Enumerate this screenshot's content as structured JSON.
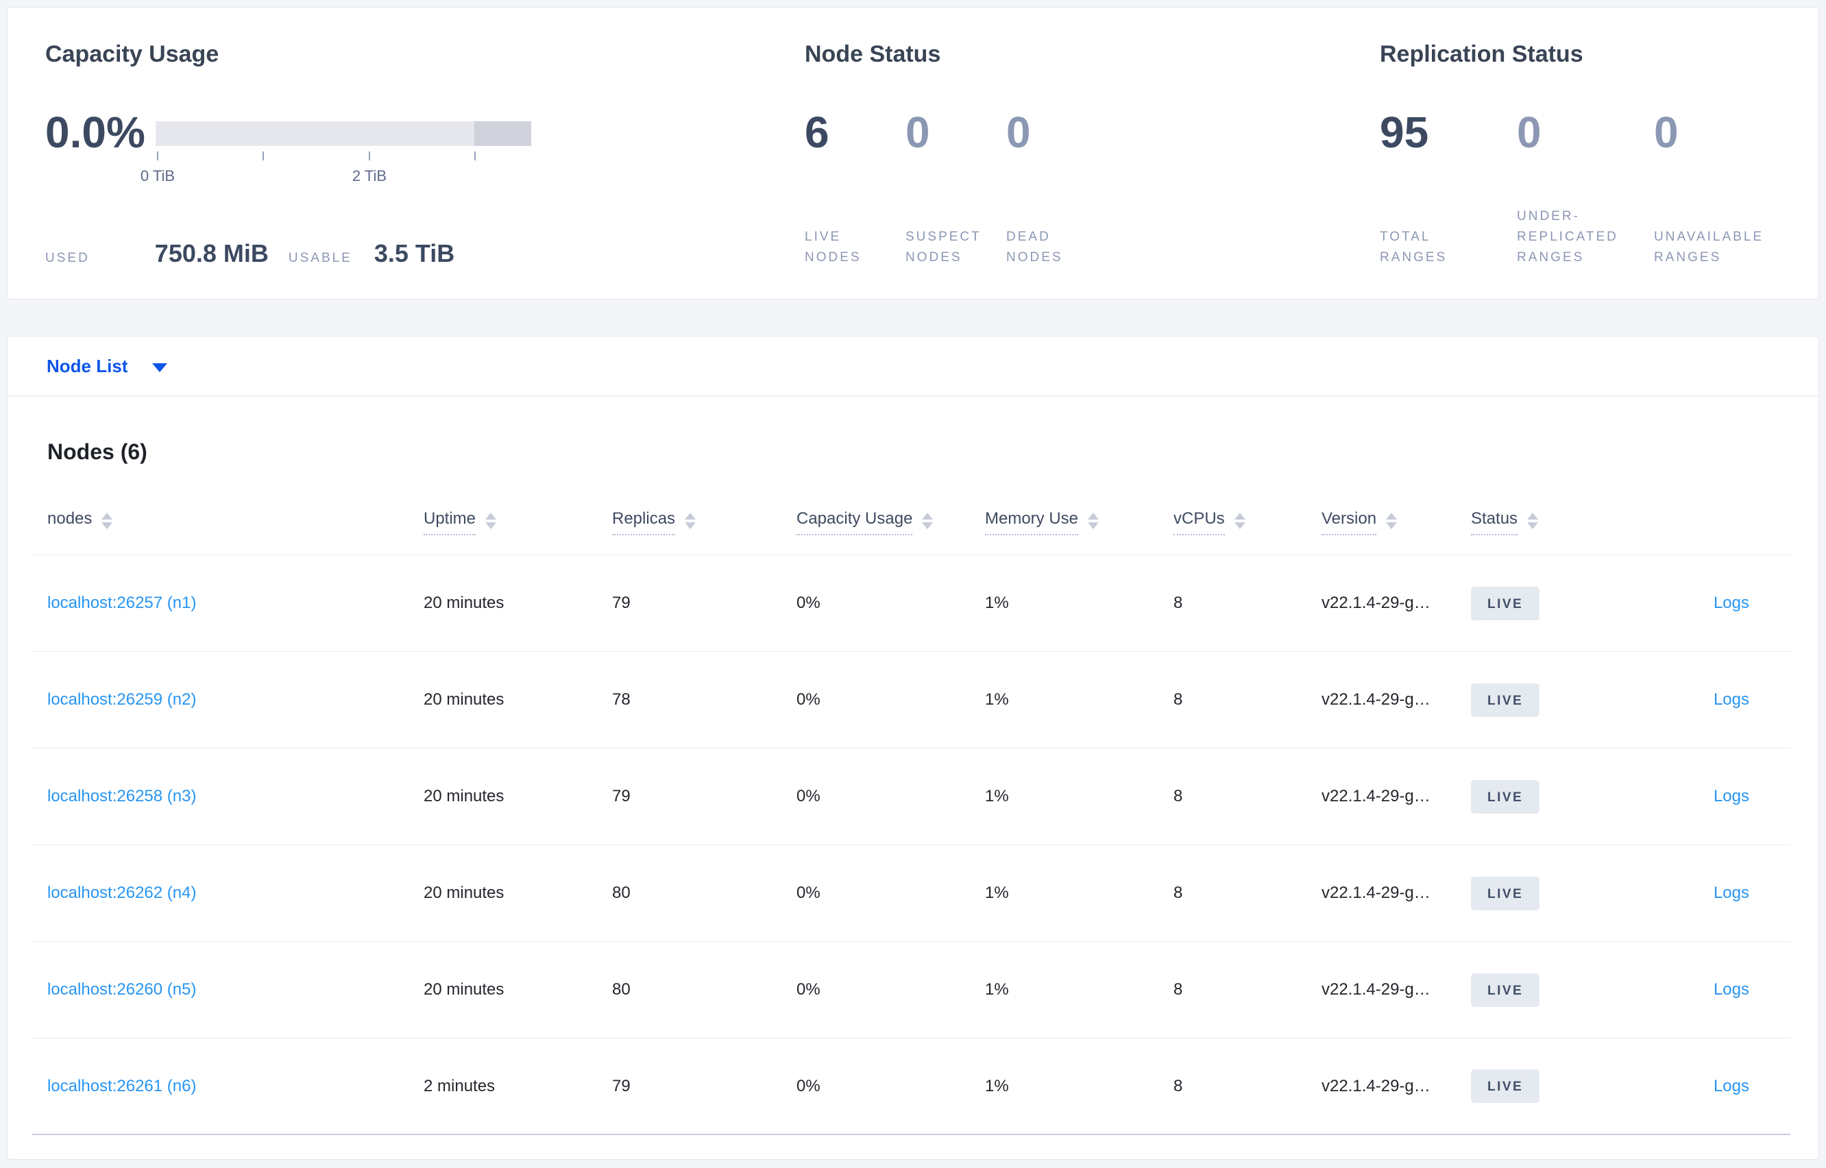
{
  "summary": {
    "capacity": {
      "title": "Capacity Usage",
      "percent": "0.0%",
      "axis_tick_0": "0 TiB",
      "axis_tick_2": "2 TiB",
      "used_label": "USED",
      "used_value": "750.8 MiB",
      "usable_label": "USABLE",
      "usable_value": "3.5 TiB"
    },
    "node_status": {
      "title": "Node Status",
      "stats": [
        {
          "value": "6",
          "label": "LIVE\nNODES"
        },
        {
          "value": "0",
          "label": "SUSPECT\nNODES"
        },
        {
          "value": "0",
          "label": "DEAD\nNODES"
        }
      ]
    },
    "replication_status": {
      "title": "Replication Status",
      "stats": [
        {
          "value": "95",
          "label": "TOTAL\nRANGES"
        },
        {
          "value": "0",
          "label": "UNDER-\nREPLICATED\nRANGES"
        },
        {
          "value": "0",
          "label": "UNAVAILABLE\nRANGES"
        }
      ]
    }
  },
  "node_list": {
    "dropdown_label": "Node List",
    "section_title": "Nodes (6)",
    "columns": {
      "nodes": "nodes",
      "uptime": "Uptime",
      "replicas": "Replicas",
      "capacity": "Capacity Usage",
      "memory": "Memory Use",
      "vcpus": "vCPUs",
      "version": "Version",
      "status": "Status"
    },
    "rows": [
      {
        "address": "localhost:26257 (n1)",
        "uptime": "20 minutes",
        "replicas": "79",
        "capacity": "0%",
        "memory": "1%",
        "vcpus": "8",
        "version": "v22.1.4-29-g…",
        "status": "LIVE",
        "logs": "Logs"
      },
      {
        "address": "localhost:26259 (n2)",
        "uptime": "20 minutes",
        "replicas": "78",
        "capacity": "0%",
        "memory": "1%",
        "vcpus": "8",
        "version": "v22.1.4-29-g…",
        "status": "LIVE",
        "logs": "Logs"
      },
      {
        "address": "localhost:26258 (n3)",
        "uptime": "20 minutes",
        "replicas": "79",
        "capacity": "0%",
        "memory": "1%",
        "vcpus": "8",
        "version": "v22.1.4-29-g…",
        "status": "LIVE",
        "logs": "Logs"
      },
      {
        "address": "localhost:26262 (n4)",
        "uptime": "20 minutes",
        "replicas": "80",
        "capacity": "0%",
        "memory": "1%",
        "vcpus": "8",
        "version": "v22.1.4-29-g…",
        "status": "LIVE",
        "logs": "Logs"
      },
      {
        "address": "localhost:26260 (n5)",
        "uptime": "20 minutes",
        "replicas": "80",
        "capacity": "0%",
        "memory": "1%",
        "vcpus": "8",
        "version": "v22.1.4-29-g…",
        "status": "LIVE",
        "logs": "Logs"
      },
      {
        "address": "localhost:26261 (n6)",
        "uptime": "2 minutes",
        "replicas": "79",
        "capacity": "0%",
        "memory": "1%",
        "vcpus": "8",
        "version": "v22.1.4-29-g…",
        "status": "LIVE",
        "logs": "Logs"
      }
    ]
  },
  "colors": {
    "page_bg": "#f4f5f9",
    "accent_blue": "#0d55eb",
    "link_blue": "#2795f2",
    "dark_slate": "#3c4961",
    "muted_slate": "#8c97b4",
    "badge_bg": "#e5e9f0",
    "bar_light": "#e7e8ed",
    "bar_dark": "#cfd2db"
  }
}
